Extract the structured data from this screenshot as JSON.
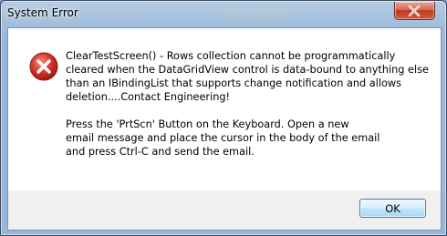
{
  "window": {
    "title": "System Error",
    "close_icon": "close-icon",
    "close_button_color": "#c7452b"
  },
  "message": {
    "icon": "error-icon",
    "icon_color": "#d32f2f",
    "lines": [
      "ClearTestScreen() - Rows collection cannot be programmatically",
      "cleared when the DataGridView control is data-bound to anything else",
      "than an IBindingList that supports change notification and allows",
      "deletion....Contact Engineering!",
      "Press the 'PrtScn' Button on the Keyboard. Open a new",
      "email message and place the cursor in the body of the email",
      "and press Ctrl-C and send the email."
    ]
  },
  "buttons": {
    "ok_label": "OK"
  }
}
